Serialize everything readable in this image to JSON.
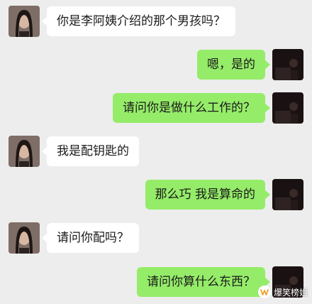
{
  "colors": {
    "background": "#ededed",
    "incoming_bubble": "#ffffff",
    "outgoing_bubble": "#95ec69"
  },
  "messages": [
    {
      "side": "left",
      "text": "你是李阿姨介绍的那个男孩吗？"
    },
    {
      "side": "right",
      "text": "嗯，是的"
    },
    {
      "side": "right",
      "text": "请问你是做什么工作的？"
    },
    {
      "side": "left",
      "text": "我是配钥匙的"
    },
    {
      "side": "right",
      "text": "那么巧 我是算命的"
    },
    {
      "side": "left",
      "text": "请问你配吗？"
    },
    {
      "side": "right",
      "text": "请问你算什么东西？"
    }
  ],
  "watermark": {
    "text": "爆笑榜姐",
    "icon": "wechat-channel-icon"
  }
}
